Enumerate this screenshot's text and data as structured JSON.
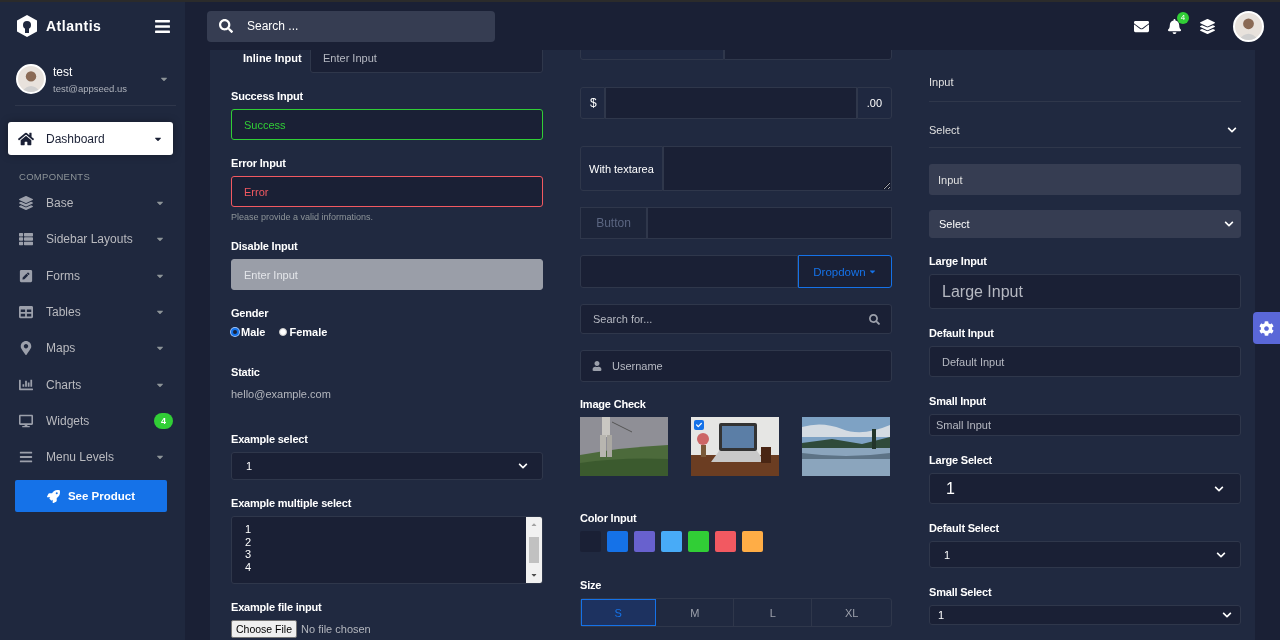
{
  "header": {
    "brand": "Atlantis",
    "search": {
      "placeholder": "Search ..."
    },
    "notifications": {
      "badge": "4"
    }
  },
  "sidebar": {
    "user": {
      "name": "test",
      "email": "test@appseed.us"
    },
    "nav": [
      {
        "kind": "item",
        "label": "Dashboard",
        "selected": true
      },
      {
        "kind": "heading",
        "label": "COMPONENTS"
      },
      {
        "kind": "item",
        "label": "Base",
        "selected": false
      },
      {
        "kind": "item",
        "label": "Sidebar Layouts",
        "selected": false
      },
      {
        "kind": "item",
        "label": "Forms",
        "selected": false
      },
      {
        "kind": "item",
        "label": "Tables",
        "selected": false
      },
      {
        "kind": "item",
        "label": "Maps",
        "selected": false
      },
      {
        "kind": "item",
        "label": "Charts",
        "selected": false
      },
      {
        "kind": "item",
        "label": "Widgets",
        "selected": false,
        "badge": "4"
      },
      {
        "kind": "item",
        "label": "Menu Levels",
        "selected": false
      }
    ],
    "cta": "See Product"
  },
  "columns": [
    {
      "fields": [
        {
          "kind": "inline",
          "label": "Inline Input",
          "placeholder": "Enter Input"
        },
        {
          "kind": "success_input",
          "label": "Success Input",
          "value": "Success"
        },
        {
          "kind": "error_input",
          "label": "Error Input",
          "value": "Error",
          "help": "Please provide a valid informations."
        },
        {
          "kind": "input",
          "label": "Disable Input",
          "placeholder": "Enter Input",
          "disabled": true
        },
        {
          "kind": "radios",
          "label": "Gender",
          "options": [
            {
              "label": "Male",
              "selected": true
            },
            {
              "label": "Female",
              "selected": false
            }
          ]
        },
        {
          "kind": "static",
          "label": "Static",
          "value": "hello@example.com"
        },
        {
          "kind": "select",
          "label": "Example select",
          "value": "1"
        },
        {
          "kind": "multiselect",
          "label": "Example multiple select",
          "options": [
            "1",
            "2",
            "3",
            "4"
          ]
        },
        {
          "kind": "file",
          "label": "Example file input",
          "button": "Choose File",
          "status_text": "No file chosen"
        }
      ]
    },
    {
      "fields": [
        {
          "kind": "cut_group"
        },
        {
          "kind": "addon",
          "prefix": "$",
          "suffix": ".00"
        },
        {
          "kind": "textarea_group",
          "label": "With textarea"
        },
        {
          "kind": "button_group",
          "button": "Button"
        },
        {
          "kind": "dropdown_group",
          "button": "Dropdown"
        },
        {
          "kind": "search",
          "placeholder": "Search for..."
        },
        {
          "kind": "icon_input",
          "placeholder": "Username"
        },
        {
          "kind": "image_check",
          "label": "Image Check",
          "images": [
            {
              "selected": false
            },
            {
              "selected": true
            },
            {
              "selected": false
            }
          ]
        },
        {
          "kind": "colors",
          "label": "Color Input",
          "swatches": [
            {
              "color": "#1a2035"
            },
            {
              "color": "#1572e8"
            },
            {
              "color": "#6861ce"
            },
            {
              "color": "#48abf7"
            },
            {
              "color": "#31ce36"
            },
            {
              "color": "#f25961"
            },
            {
              "color": "#ffad46"
            }
          ]
        },
        {
          "kind": "sizes",
          "label": "Size",
          "options": [
            {
              "label": "S",
              "selected": true
            },
            {
              "label": "M",
              "selected": false
            },
            {
              "label": "L",
              "selected": false
            },
            {
              "label": "XL",
              "selected": false
            }
          ]
        }
      ]
    },
    {
      "fields": [
        {
          "kind": "flat_input",
          "placeholder": "Input"
        },
        {
          "kind": "flat_select",
          "value": "Select"
        },
        {
          "kind": "solid_input",
          "placeholder": "Input"
        },
        {
          "kind": "solid_select",
          "value": "Select"
        },
        {
          "kind": "large_input",
          "label": "Large Input",
          "placeholder": "Large Input"
        },
        {
          "kind": "input",
          "label": "Default Input",
          "placeholder": "Default Input"
        },
        {
          "kind": "small_input",
          "label": "Small Input",
          "placeholder": "Small Input"
        },
        {
          "kind": "large_select",
          "label": "Large Select",
          "value": "1"
        },
        {
          "kind": "select",
          "label": "Default Select",
          "value": "1"
        },
        {
          "kind": "small_select",
          "label": "Small Select",
          "value": "1"
        }
      ]
    }
  ]
}
